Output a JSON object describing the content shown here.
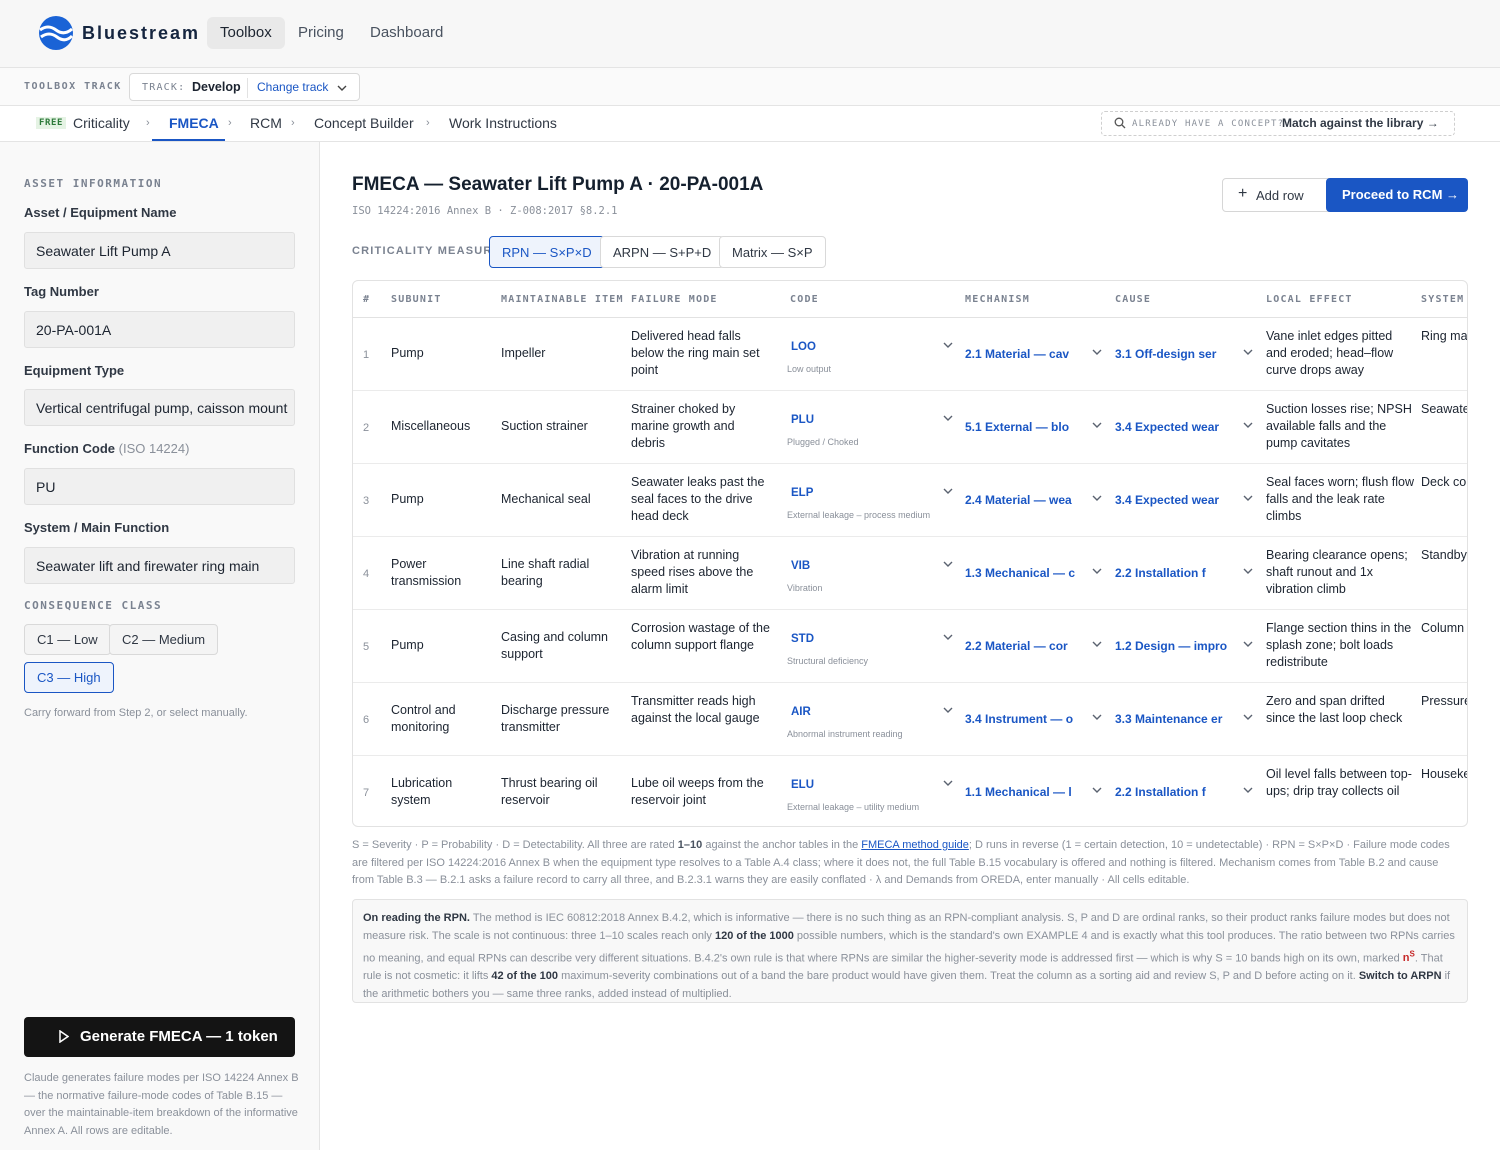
{
  "brand": "Bluestream",
  "nav": [
    "Toolbox",
    "Pricing",
    "Dashboard"
  ],
  "track": {
    "title": "TOOLBOX TRACK",
    "label": "TRACK:",
    "value": "Develop",
    "change": "Change track"
  },
  "steps": {
    "free": "FREE",
    "items": [
      "Criticality",
      "FMECA",
      "RCM",
      "Concept Builder",
      "Work Instructions"
    ],
    "already_label": "ALREADY HAVE A CONCEPT?",
    "already_link": "Match against the library →"
  },
  "sidebar": {
    "section": "ASSET INFORMATION",
    "asset_label": "Asset / Equipment Name",
    "asset_value": "Seawater Lift Pump A",
    "tag_label": "Tag Number",
    "tag_value": "20-PA-001A",
    "type_label": "Equipment Type",
    "type_value": "Vertical centrifugal pump, caisson mount",
    "func_label": "Function Code",
    "func_sub": "(ISO 14224)",
    "func_value": "PU",
    "sys_label": "System / Main Function",
    "sys_value": "Seawater lift and firewater ring main",
    "cons_label": "CONSEQUENCE CLASS",
    "cons": [
      "C1 — Low",
      "C2 — Medium",
      "C3 — High"
    ],
    "carry": "Carry forward from Step 2, or select manually.",
    "generate": "Generate FMECA — 1 token",
    "gen_note": "Claude generates failure modes per ISO 14224 Annex B — the normative failure-mode codes of Table B.15 — over the maintainable-item breakdown of the informative Annex A. All rows are editable."
  },
  "main": {
    "title": "FMECA — Seawater Lift Pump A · 20-PA-001A",
    "subtitle": "ISO 14224:2016 Annex B · Z-008:2017 §8.2.1",
    "add_row": "Add row",
    "proceed": "Proceed to RCM →",
    "measure_label": "CRITICALITY MEASURE",
    "measures": [
      "RPN — S×P×D",
      "ARPN — S+P+D",
      "Matrix — S×P"
    ],
    "columns": [
      "#",
      "SUBUNIT",
      "MAINTAINABLE ITEM",
      "FAILURE MODE",
      "CODE",
      "MECHANISM",
      "CAUSE",
      "LOCAL EFFECT",
      "SYSTEM"
    ],
    "rows": [
      {
        "n": "1",
        "subunit": "Pump",
        "item": "Impeller",
        "mode": "Delivered head falls below the ring main set point",
        "code": "LOO",
        "code_desc": "Low output",
        "mech": "2.1 Material — cav",
        "cause": "3.1 Off-design ser",
        "local": "Vane inlet edges pitted and eroded; head–flow curve drops away",
        "system": "Ring mai at press firewater"
      },
      {
        "n": "2",
        "subunit": "Miscellaneous",
        "item": "Suction strainer",
        "mode": "Strainer choked by marine growth and debris",
        "code": "PLU",
        "code_desc": "Plugged / Choked",
        "mech": "5.1 External — blo",
        "cause": "3.4 Expected wear",
        "local": "Suction losses rise; NPSH available falls and the pump cavitates",
        "system": "Seawate cooling a users th"
      },
      {
        "n": "3",
        "subunit": "Pump",
        "item": "Mechanical seal",
        "mode": "Seawater leaks past the seal faces to the drive head deck",
        "code": "ELP",
        "code_desc": "External leakage – process medium",
        "mech": "2.4 Material — wea",
        "cause": "3.4 Expected wear",
        "local": "Seal faces worn; flush flow falls and the leak rate climbs",
        "system": "Deck co pump of cartridge"
      },
      {
        "n": "4",
        "subunit": "Power transmission",
        "item": "Line shaft radial bearing",
        "mode": "Vibration at running speed rises above the alarm limit",
        "code": "VIB",
        "code_desc": "Vibration",
        "mech": "1.3 Mechanical — c",
        "cause": "2.2 Installation f",
        "local": "Bearing clearance opens; shaft runout and 1x vibration climb",
        "system": "Standby duty; un the caiss"
      },
      {
        "n": "5",
        "subunit": "Pump",
        "item": "Casing and column support",
        "mode": "Corrosion wastage of the column support flange",
        "code": "STD",
        "code_desc": "Structural deficiency",
        "mech": "2.2 Material — cor",
        "cause": "1.2 Design — impro",
        "local": "Flange section thins in the splash zone; bolt loads redistribute",
        "system": "Column into the the bore"
      },
      {
        "n": "6",
        "subunit": "Control and monitoring",
        "item": "Discharge pressure transmitter",
        "mode": "Transmitter reads high against the local gauge",
        "code": "AIR",
        "code_desc": "Abnormal instrument reading",
        "mech": "3.4 Instrument — o",
        "cause": "3.3 Maintenance er",
        "local": "Zero and span drifted since the last loop check",
        "system": "Pressure daily log recalibra"
      },
      {
        "n": "7",
        "subunit": "Lubrication system",
        "item": "Thrust bearing oil reservoir",
        "mode": "Lube oil weeps from the reservoir joint",
        "code": "ELU",
        "code_desc": "External leakage – utility medium",
        "mech": "1.1 Mechanical — l",
        "cause": "2.2 Installation f",
        "local": "Oil level falls between top-ups; drip tray collects oil",
        "system": "Houseke the drive duty una"
      }
    ],
    "legend_a": "S = Severity · P = Probability · D = Detectability. All three are rated ",
    "legend_b": "1–10",
    "legend_c": " against the anchor tables in the ",
    "legend_link": "FMECA method guide",
    "legend_d": "; D runs in reverse (1 = certain detection, 10 = undetectable) · RPN = S×P×D · Failure mode codes are filtered per ISO 14224:2016 Annex B when the equipment type resolves to a Table A.4 class; where it does not, the full Table B.15 vocabulary is offered and nothing is filtered. Mechanism comes from Table B.2 and cause from Table B.3 — B.2.1 asks a failure record to carry all three, and B.2.3.1 warns they are easily conflated · λ and Demands from OREDA, enter manually · All cells editable.",
    "rpn_title": "On reading the RPN.",
    "rpn_a": " The method is IEC 60812:2018 Annex B.4.2, which is informative — there is no such thing as an RPN-compliant analysis. S, P and D are ordinal ranks, so their product ranks failure modes but does not measure risk. The scale is not continuous: three 1–10 scales reach only ",
    "rpn_b": "120 of the 1000",
    "rpn_c": " possible numbers, which is the standard's own EXAMPLE 4 and is exactly what this tool produces. The ratio between two RPNs carries no meaning, and equal RPNs can describe very different situations. B.4.2's own rule is that where RPNs are similar the higher-severity mode is addressed first — which is why S = 10 bands high on its own, marked ",
    "rpn_mark": "n",
    "rpn_sup": "S",
    "rpn_d": ". That rule is not cosmetic: it lifts ",
    "rpn_e": "42 of the 100",
    "rpn_f": " maximum-severity combinations out of a band the bare product would have given them. Treat the column as a sorting aid and review S, P and D before acting on it. ",
    "rpn_g": "Switch to ARPN",
    "rpn_h": " if the arithmetic bothers you — same three ranks, added instead of multiplied.",
    "colors": {
      "accent": "#1a56c4",
      "dark": "#141414"
    }
  }
}
